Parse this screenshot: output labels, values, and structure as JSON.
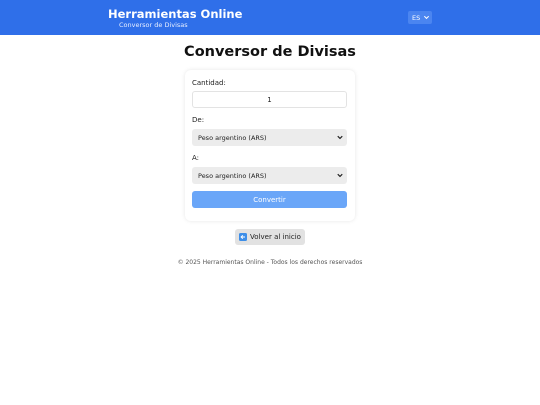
{
  "header": {
    "title": "Herramientas Online",
    "subtitle": "Conversor de Divisas",
    "language": "ES",
    "accent_color": "#2f6fe9"
  },
  "main": {
    "page_title": "Conversor de Divisas",
    "form": {
      "amount_label": "Cantidad:",
      "amount_value": "1",
      "from_label": "De:",
      "from_value": "Peso argentino (ARS)",
      "to_label": "A:",
      "to_value": "Peso argentino (ARS)",
      "convert_label": "Convertir"
    },
    "back_label": "Volver al inicio",
    "back_icon": "left-arrow-icon"
  },
  "footer": {
    "text": "© 2025 Herramientas Online - Todos los derechos reservados"
  }
}
